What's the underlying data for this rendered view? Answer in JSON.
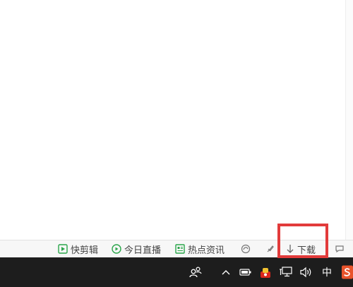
{
  "status_bar": {
    "items": [
      {
        "label": "快剪辑",
        "icon": "video-edit-icon"
      },
      {
        "label": "今日直播",
        "icon": "live-play-icon"
      },
      {
        "label": "热点资讯",
        "icon": "news-icon"
      }
    ],
    "download_label": "下载",
    "accent_color": "#2aa54a"
  },
  "taskbar": {
    "ime_label": "中",
    "highlight_color": "#e23b3b"
  }
}
